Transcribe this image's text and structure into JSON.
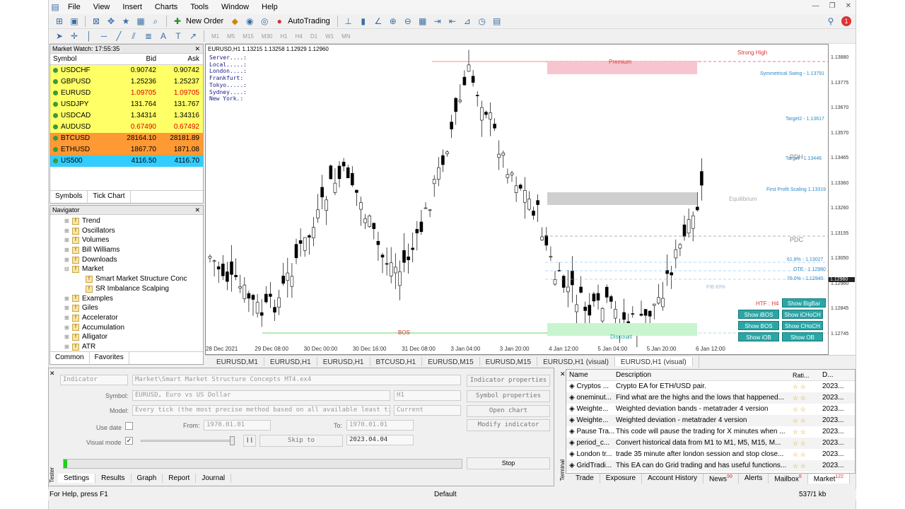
{
  "menu": [
    "File",
    "View",
    "Insert",
    "Charts",
    "Tools",
    "Window",
    "Help"
  ],
  "toolbar": {
    "new_order": "New Order",
    "autotrading": "AutoTrading"
  },
  "timeframes": [
    "M1",
    "M5",
    "M15",
    "M30",
    "H1",
    "H4",
    "D1",
    "W1",
    "MN"
  ],
  "market_watch": {
    "title": "Market Watch: 17:55:35",
    "headers": [
      "Symbol",
      "Bid",
      "Ask"
    ],
    "rows": [
      {
        "s": "USDCHF",
        "b": "0.90742",
        "a": "0.90742",
        "bg": "#ffff66"
      },
      {
        "s": "GBPUSD",
        "b": "1.25236",
        "a": "1.25237",
        "bg": "#ffff66"
      },
      {
        "s": "EURUSD",
        "b": "1.09705",
        "a": "1.09705",
        "bg": "#ffff66"
      },
      {
        "s": "USDJPY",
        "b": "131.764",
        "a": "131.767",
        "bg": "#ffff66"
      },
      {
        "s": "USDCAD",
        "b": "1.34314",
        "a": "1.34316",
        "bg": "#ffff66"
      },
      {
        "s": "AUDUSD",
        "b": "0.67490",
        "a": "0.67492",
        "bg": "#ffff66"
      },
      {
        "s": "BTCUSD",
        "b": "28164.10",
        "a": "28181.89",
        "bg": "#ff9933"
      },
      {
        "s": "ETHUSD",
        "b": "1867.70",
        "a": "1871.08",
        "bg": "#ff9933"
      },
      {
        "s": "US500",
        "b": "4116.50",
        "a": "4116.70",
        "bg": "#33ccff"
      }
    ],
    "tabs": [
      "Symbols",
      "Tick Chart"
    ]
  },
  "navigator": {
    "title": "Navigator",
    "items": [
      "Trend",
      "Oscillators",
      "Volumes",
      "Bill Williams",
      "Downloads",
      "Market",
      "Smart Market Structure Conc",
      "SR Imbalance Scalping",
      "Examples",
      "Giles",
      "Accelerator",
      "Accumulation",
      "Alligator",
      "ATR"
    ],
    "tabs": [
      "Common",
      "Favorites"
    ]
  },
  "chart": {
    "header": "EURUSD,H1  1.13215 1.13258 1.12929 1.12960",
    "sessions": [
      "Server....:",
      "Local.....:",
      "London....:",
      "Frankfurt:",
      "Tokyo.....:",
      "Sydney....:",
      "New York.:"
    ],
    "labels": {
      "premium": "Premium",
      "strong_high": "Strong High",
      "discount": "Discount",
      "equilibrium": "Equilibrium",
      "pdh": "PDH",
      "pdc": "PDC",
      "bos": "BOS",
      "sym_swing": "Symmetrical Swing - 1.13791",
      "target2": "Target2 - 1.13617",
      "target": "Target - 1.13446",
      "first_profit": "First Profit Scaling 1.13319",
      "fib618": "61.8% - 1.13027",
      "ote": "OTE - 1.12980",
      "fib79": "79.0% - 1.12940",
      "fib83": "FIB 83%",
      "htf": "HTF : H4"
    },
    "buttons": [
      "Show BigBar",
      "Show iBOS",
      "Show iCHoCH",
      "Show BOS",
      "Show CHoCH",
      "Show iOB",
      "Show OB"
    ],
    "price_labels": [
      "1.13880",
      "1.13775",
      "1.13670",
      "1.13570",
      "1.13465",
      "1.13360",
      "1.13260",
      "1.13155",
      "1.13050",
      "1.12960",
      "1.12845",
      "1.12745"
    ],
    "current_price": "1.12960",
    "date_labels": [
      "28 Dec 2021",
      "29 Dec 08:00",
      "30 Dec 00:00",
      "30 Dec 16:00",
      "31 Dec 08:00",
      "3 Jan 04:00",
      "3 Jan 20:00",
      "4 Jan 12:00",
      "5 Jan 04:00",
      "5 Jan 20:00",
      "6 Jan 12:00"
    ]
  },
  "chart_tabs": [
    "EURUSD,M1",
    "EURUSD,H1",
    "EURUSD,H1",
    "BTCUSD,H1",
    "EURUSD,M15",
    "EURUSD,M15",
    "EURUSD,H1 (visual)",
    "EURUSD,H1 (visual)"
  ],
  "tester": {
    "type": "Indicator",
    "path": "Market\\Smart Market Structure Concepts MT4.ex4",
    "symbol_label": "Symbol:",
    "symbol": "EURUSD, Euro vs US Dollar",
    "period": "H1",
    "model_label": "Model:",
    "model": "Every tick (the most precise method based on all available least timefram",
    "model2": "Current",
    "use_date": "Use date",
    "from_label": "From:",
    "from": "1970.01.01",
    "to_label": "To:",
    "to": "1970.01.01",
    "visual_mode": "Visual mode",
    "skip_to": "Skip to",
    "skip_date": "2023.04.04",
    "btn_ind_props": "Indicator properties",
    "btn_sym_props": "Symbol properties",
    "btn_open_chart": "Open chart",
    "btn_modify": "Modify indicator",
    "btn_stop": "Stop",
    "tabs": [
      "Settings",
      "Results",
      "Graph",
      "Report",
      "Journal"
    ],
    "side_label": "Tester"
  },
  "terminal": {
    "headers": [
      "Name",
      "Description",
      "Rati...",
      "D..."
    ],
    "rows": [
      {
        "n": "Cryptos ...",
        "d": "Crypto EA for ETH/USD pair.",
        "dt": "2023..."
      },
      {
        "n": "oneminut...",
        "d": "Find what are the highs and the lows that happened...",
        "dt": "2023..."
      },
      {
        "n": "Weighte...",
        "d": "Weighted deviation bands - metatrader 4 version",
        "dt": "2023..."
      },
      {
        "n": "Weighte...",
        "d": "Weighted deviation - metatrader 4 version",
        "dt": "2023..."
      },
      {
        "n": "Pause Tra...",
        "d": "This code will pause the trading for X minutes when ...",
        "dt": "2023..."
      },
      {
        "n": "period_c...",
        "d": "Convert historical data from M1 to M1, M5, M15, M...",
        "dt": "2023..."
      },
      {
        "n": "London tr...",
        "d": "trade 35 minute after london session and stop close...",
        "dt": "2023..."
      },
      {
        "n": "GridTradi...",
        "d": "This EA can do Grid trading and has useful functions...",
        "dt": "2023..."
      }
    ],
    "tabs": [
      "Trade",
      "Exposure",
      "Account History",
      "News",
      "Alerts",
      "Mailbox",
      "Market"
    ],
    "news_badge": "99",
    "mailbox_badge": "8",
    "market_badge": "122",
    "side_label": "Terminal"
  },
  "status": {
    "help": "For Help, press F1",
    "profile": "Default",
    "traffic": "537/1 kb"
  },
  "notification_count": "1"
}
